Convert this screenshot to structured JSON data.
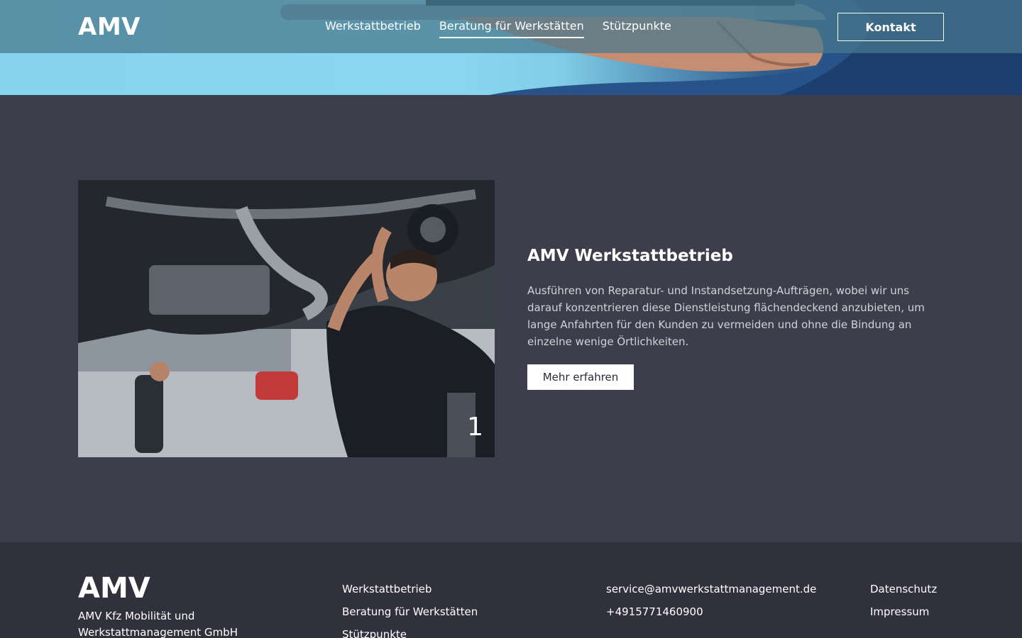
{
  "header": {
    "logo": "AMV",
    "nav": [
      {
        "label": "Werkstattbetrieb",
        "active": false
      },
      {
        "label": "Beratung für Werkstätten",
        "active": true
      },
      {
        "label": "Stützpunkte",
        "active": false
      }
    ],
    "cta_label": "Kontakt"
  },
  "feature": {
    "title": "AMV Werkstattbetrieb",
    "text": "Ausführen von Reparatur- und Instandsetzung-Aufträgen, wobei wir uns darauf konzentrieren diese Dienstleistung flächendeckend anzubieten, um lange Anfahrten für den Kunden zu vermeiden und ohne die Bindung an einzelne wenige Örtlichkeiten.",
    "button_label": "Mehr erfahren",
    "slide_number": "1"
  },
  "footer": {
    "logo": "AMV",
    "company": "AMV Kfz Mobilität und Werkstattmanagement GmbH",
    "nav": [
      "Werkstattbetrieb",
      "Beratung für Werkstätten",
      "Stützpunkte"
    ],
    "contact": [
      "service@amvwerkstattmanagement.de",
      "+4915771460900"
    ],
    "legal": [
      "Datenschutz",
      "Impressum"
    ]
  },
  "colors": {
    "page_bg": "#3d3d4b",
    "footer_bg": "#31313d",
    "header_bg": "#48788c",
    "hero_sky": "#86d4ee"
  },
  "icons": {
    "hero": "tablet-in-hand-photo",
    "feature": "mechanic-under-car-photo"
  }
}
